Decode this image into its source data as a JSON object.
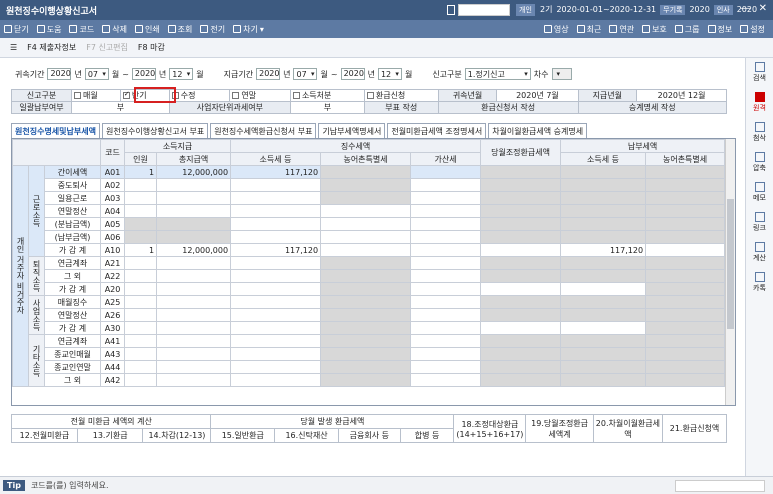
{
  "window": {
    "title": "원천징수이행상황신고서",
    "gae_label": "개인",
    "period_label": "2기",
    "period": "2020-01-01~2020-12-31",
    "tag1": "무기록",
    "year1": "2020",
    "tag2": "인사",
    "year2": "2020"
  },
  "toolbar": {
    "items": [
      "닫기",
      "도움",
      "코드",
      "삭제",
      "인쇄",
      "조회",
      "전기",
      "차기"
    ],
    "right_items": [
      "영상",
      "최근",
      "연관",
      "보호",
      "그룹",
      "정보",
      "설정"
    ]
  },
  "fkeys": {
    "f4": "F4 제출자정보",
    "f7": "F7 신고편집",
    "f8": "F8 마감"
  },
  "sidebar": [
    "검색",
    "원격",
    "첨삭",
    "압축",
    "메모",
    "링크",
    "계산",
    "카톡"
  ],
  "filters": {
    "period_label": "귀속기간",
    "y1": "2020",
    "nyeon": "년",
    "m1": "07",
    "wol": "월",
    "tilde": "~",
    "y2": "2020",
    "m2": "12",
    "pay_label": "지급기간",
    "py1": "2020",
    "pm1": "07",
    "py2": "2020",
    "pm2": "12",
    "report_label": "신고구분",
    "report_value": "1.정기신고",
    "cha_label": "차수"
  },
  "info": {
    "r1": {
      "c1": "신고구분",
      "cb1": "매월",
      "cb2": "반기",
      "cb3": "수정",
      "cb4": "연말",
      "cb5": "소득처분",
      "cb6": "환급신청",
      "c7": "귀속년월",
      "c8": "2020년 7월",
      "c9": "지급년월",
      "c10": "2020년 12월"
    },
    "r2": {
      "c1": "일괄납부여부",
      "c2": "부",
      "c3": "사업자단위과세여부",
      "c4": "부",
      "c5": "부표 작성",
      "c6": "환급신청서 작성",
      "c7": "승계명세 작성"
    }
  },
  "tabs": [
    "원천징수명세및납부세액",
    "원천징수이행상황신고서 부표",
    "원천징수세액환급신청서 부표",
    "기납부세액명세서",
    "전월미환급세액 조정명세서",
    "차월이월환급세액 승계명세"
  ],
  "grid": {
    "h_code": "코드",
    "h_pay": "소득지급",
    "h_tax": "징수세액",
    "h_adj": "당월조정환급세액",
    "h_paid": "납부세액",
    "h_people": "인원",
    "h_total": "총지급액",
    "h_income": "소득세 등",
    "h_rural": "농어촌특별세",
    "h_add": "가산세",
    "h_income2": "소득세 등",
    "h_rural2": "농어촌특별세",
    "side_big": "개인 거주자 비거주자",
    "g_labor": "근로소득",
    "g_retire": "퇴직소득",
    "g_biz": "사업소득",
    "g_other": "기타소득",
    "rows": [
      {
        "label": "간이세액",
        "code": "A01",
        "people": "1",
        "total": "12,000,000",
        "income": "117,120",
        "paid": ""
      },
      {
        "label": "중도퇴사",
        "code": "A02"
      },
      {
        "label": "일용근로",
        "code": "A03"
      },
      {
        "label": "연말정산",
        "code": "A04"
      },
      {
        "label": "(분납금액)",
        "code": "A05"
      },
      {
        "label": "(납부금액)",
        "code": "A06"
      },
      {
        "label": "가 감 계",
        "code": "A10",
        "people": "1",
        "total": "12,000,000",
        "income": "117,120",
        "paid": "117,120"
      },
      {
        "label": "연금계좌",
        "code": "A21"
      },
      {
        "label": "그 외",
        "code": "A22"
      },
      {
        "label": "가 감 계",
        "code": "A20"
      },
      {
        "label": "매월징수",
        "code": "A25"
      },
      {
        "label": "연말정산",
        "code": "A26"
      },
      {
        "label": "가 감 계",
        "code": "A30"
      },
      {
        "label": "연금계좌",
        "code": "A41"
      },
      {
        "label": "종교인매월",
        "code": "A43"
      },
      {
        "label": "종교인연말",
        "code": "A44"
      },
      {
        "label": "그 외",
        "code": "A42"
      }
    ]
  },
  "bottom": {
    "h1": "전월 미환급 세액의 계산",
    "h2": "당월 발생 환급세액",
    "h3": "18.조정대상환급(14+15+16+17)",
    "h4": "19.당월조정환급세액계",
    "h5": "20.차월이월환급세액",
    "h6": "21.환급신청액",
    "s12": "12.전월미환급",
    "s13": "13.기환급",
    "s14": "14.차감(12-13)",
    "s15": "15.일반환급",
    "s16": "16.신탁재산",
    "s17a": "금융회사 등",
    "s17b": "합병 등"
  },
  "status": {
    "tip": "Tip",
    "text": "코드를(를) 입력하세요."
  }
}
